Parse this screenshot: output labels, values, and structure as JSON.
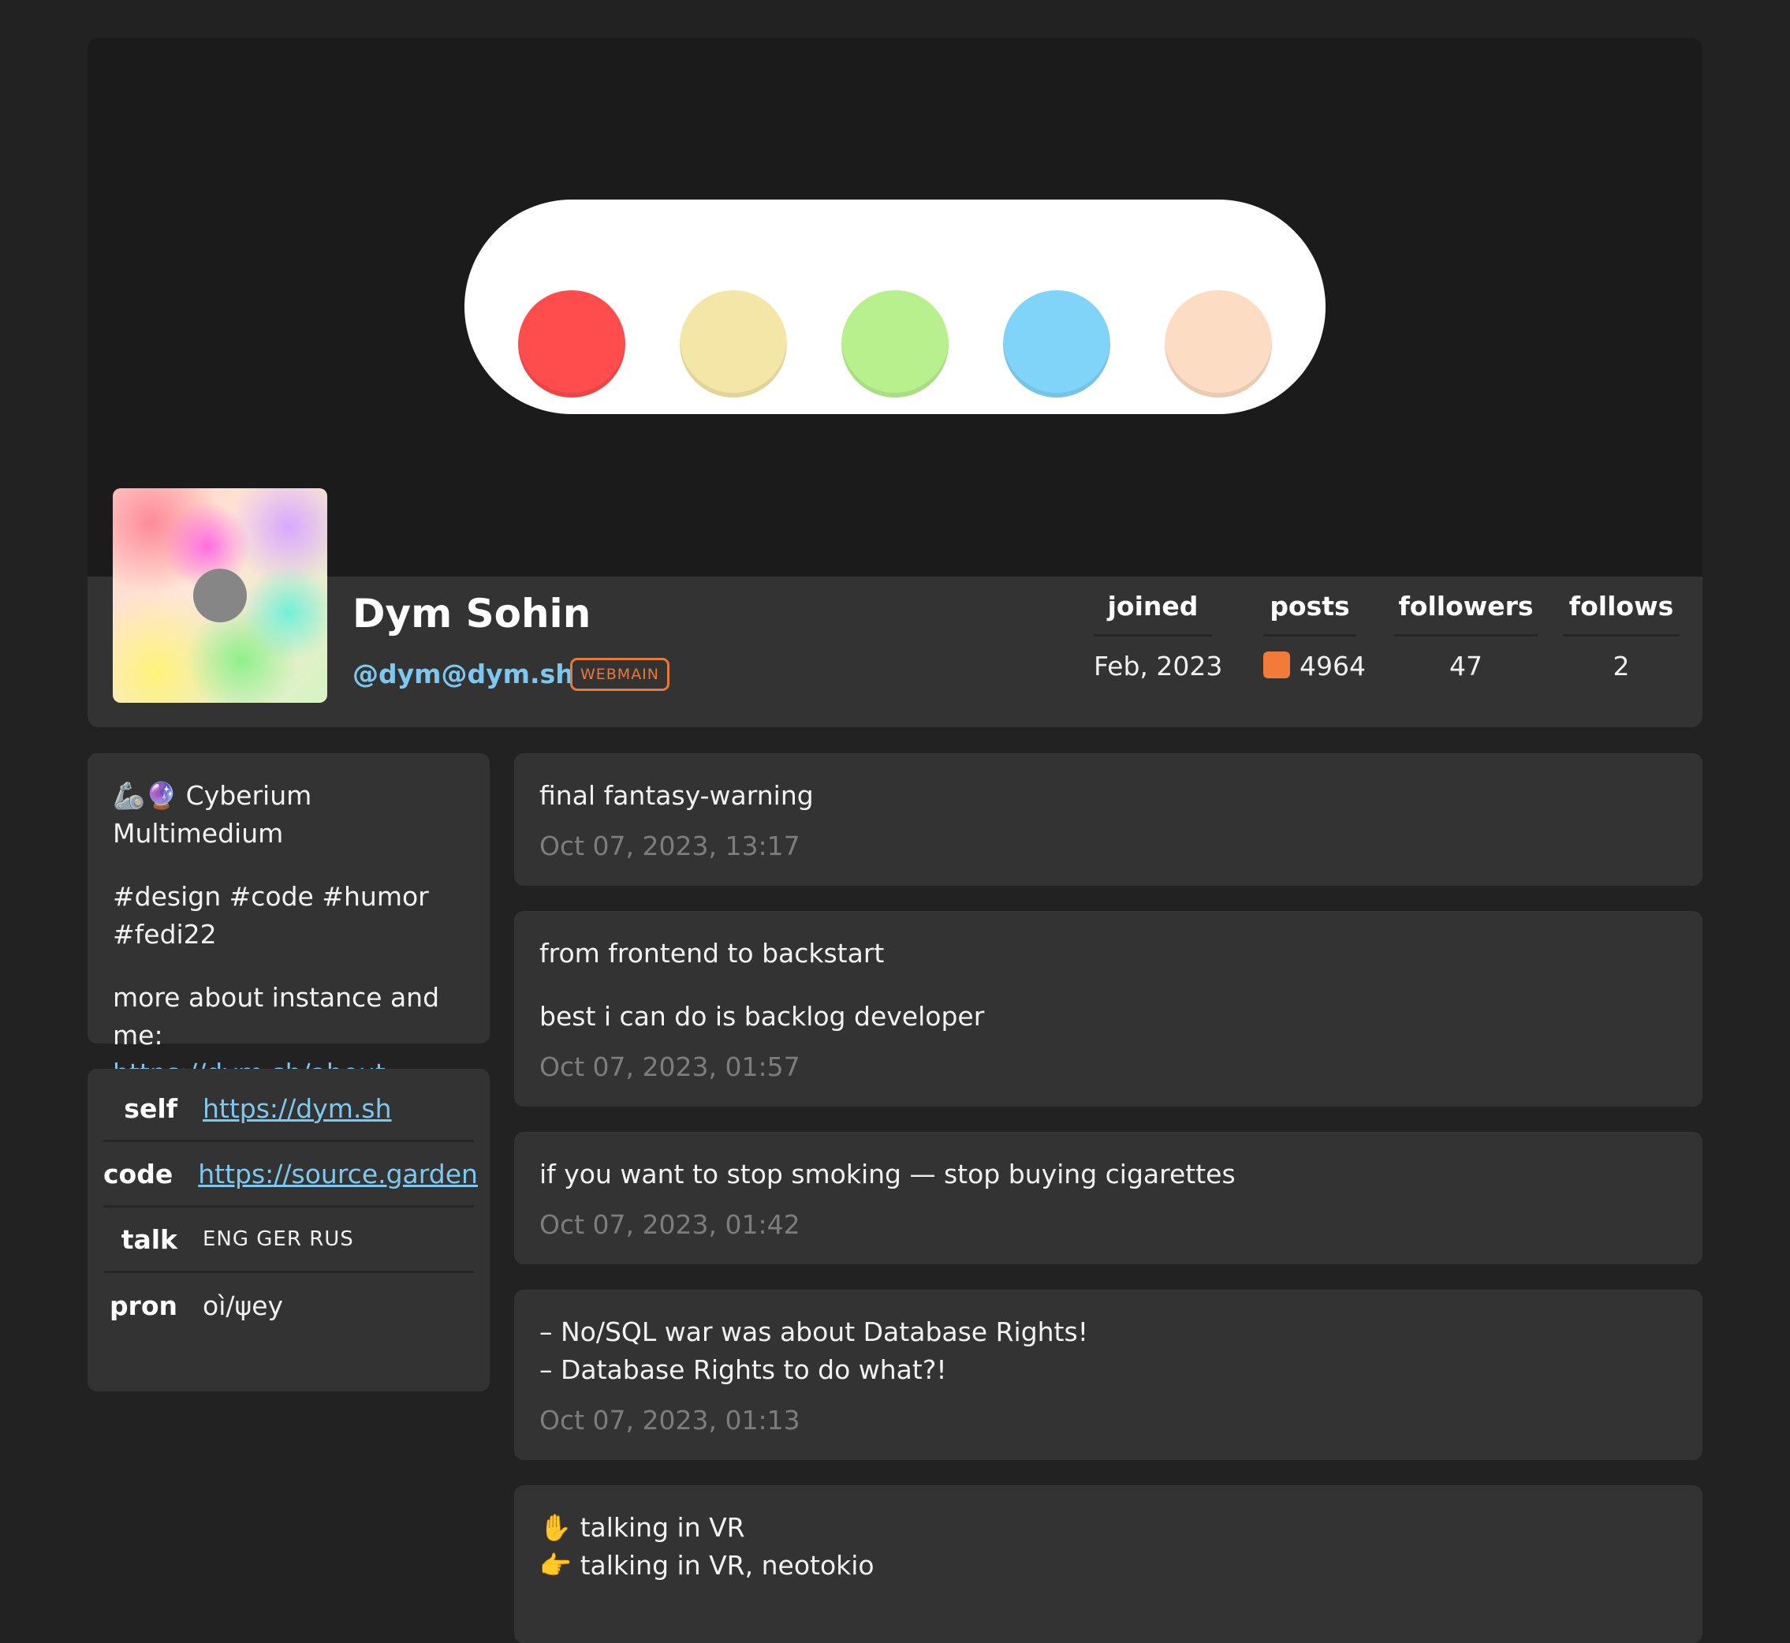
{
  "profile": {
    "name": "Dym Sohin",
    "handle": "@dym@dym.sh",
    "badge": "WEBMAIN",
    "banner_colors": [
      "#ff4d4d",
      "#f4e6a6",
      "#b8f08e",
      "#80d4fa",
      "#fddcc4"
    ],
    "stats": {
      "joined_label": "joined",
      "joined_value": "Feb, 2023",
      "posts_label": "posts",
      "posts_value": "4964",
      "followers_label": "followers",
      "followers_value": "47",
      "follows_label": "follows",
      "follows_value": "2"
    }
  },
  "about": {
    "tagline": "🦾🔮 Cyberium Multimedium",
    "tags": "#design #code #humor #fedi22",
    "more": "more about instance and me:",
    "link": "https://dym.sh/about"
  },
  "fields": [
    {
      "key": "self",
      "value": "https://dym.sh"
    },
    {
      "key": "code",
      "value": "https://source.garden"
    },
    {
      "key": "talk",
      "value": "ENG GER RUS"
    },
    {
      "key": "pron",
      "value": "oì/ψey"
    }
  ],
  "posts": [
    {
      "lines": [
        "final fantasy-warning"
      ],
      "time": "Oct 07, 2023, 13:17"
    },
    {
      "lines": [
        "from frontend to backstart",
        "best i can do is backlog developer"
      ],
      "time": "Oct 07, 2023, 01:57"
    },
    {
      "lines": [
        "if you want to stop smoking — stop buying cigarettes"
      ],
      "time": "Oct 07, 2023, 01:42"
    },
    {
      "lines": [
        "– No/SQL war was about Database Rights!",
        "– Database Rights to do what?!"
      ],
      "time": "Oct 07, 2023, 01:13"
    },
    {
      "lines": [
        "✋ talking in VR",
        "👉 talking in VR, neotokio"
      ],
      "time": ""
    }
  ]
}
